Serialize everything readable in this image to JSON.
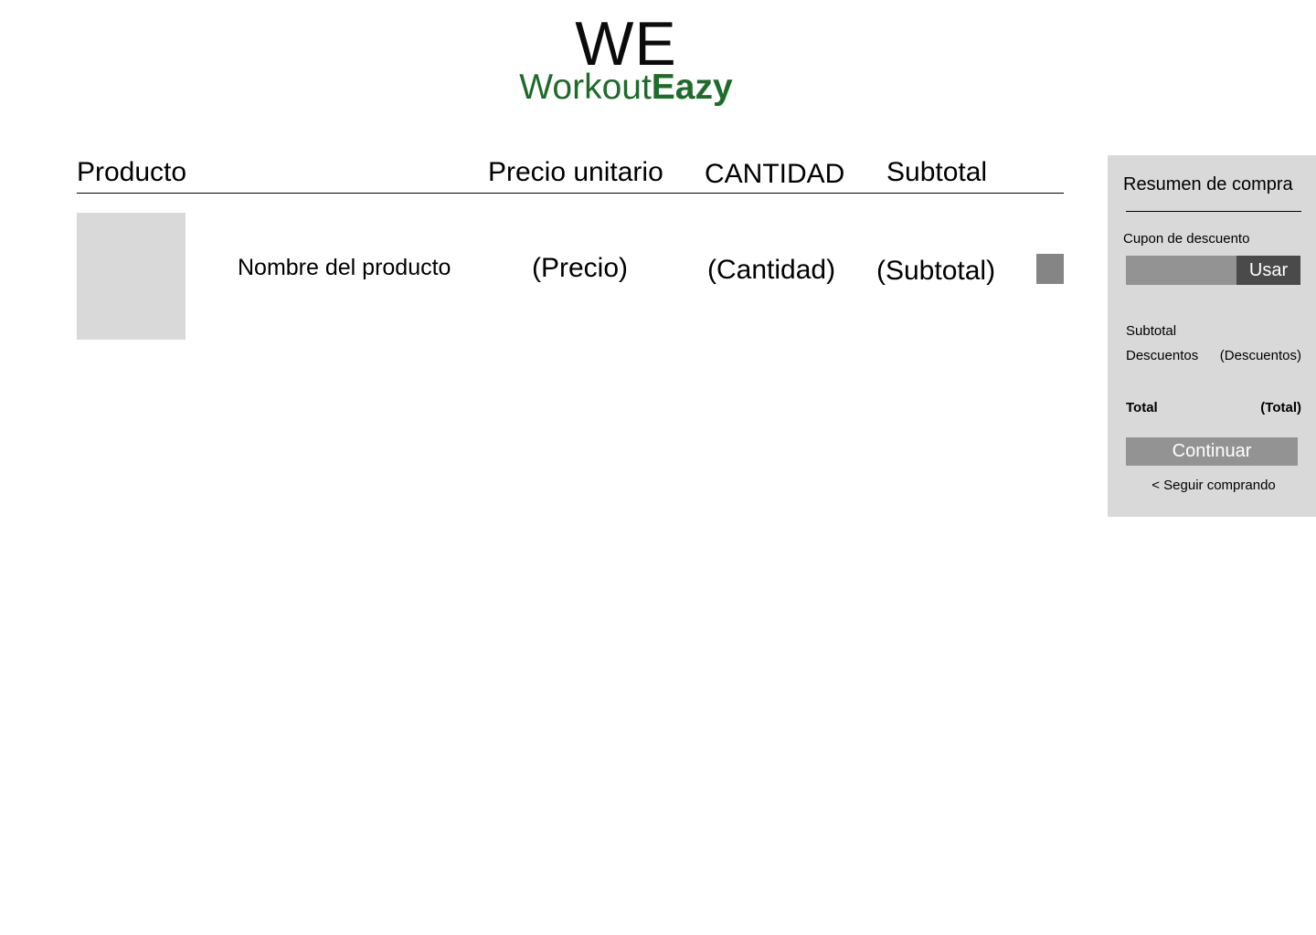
{
  "logo": {
    "mark": "WE",
    "name_regular": "Workout",
    "name_bold": "Eazy",
    "brand_color": "#1f6b2a"
  },
  "cart": {
    "headers": {
      "producto": "Producto",
      "precio": "Precio unitario",
      "cantidad": "CANTIDAD",
      "subtotal": "Subtotal"
    },
    "items": [
      {
        "name": "Nombre del producto",
        "price": "(Precio)",
        "quantity": "(Cantidad)",
        "subtotal": "(Subtotal)"
      }
    ]
  },
  "summary": {
    "title": "Resumen de compra",
    "coupon_label": "Cupon de descuento",
    "coupon_value": "",
    "coupon_button": "Usar",
    "subtotal_label": "Subtotal",
    "subtotal_value": "",
    "discounts_label": "Descuentos",
    "discounts_value": "(Descuentos)",
    "total_label": "Total",
    "total_value": "(Total)",
    "continue_button": "Continuar",
    "keep_shopping": "< Seguir comprando"
  }
}
